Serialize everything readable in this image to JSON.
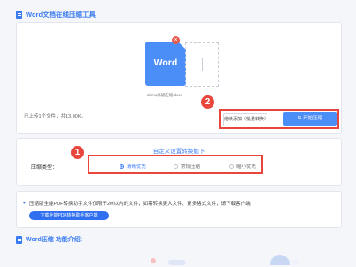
{
  "header": {
    "title": "Word文档在线压缩工具"
  },
  "upload": {
    "file_icon_label": "Word",
    "file_name": "demo高级压缩.docx",
    "summary": "已上传1个文件，共13.00K。",
    "continue_button": "继续添加（批量转换）",
    "start_button": "开始压缩",
    "start_icon": "⇅"
  },
  "settings": {
    "title": "自定义设置转换如下",
    "compression_label": "压缩类型：",
    "options": [
      "清晰优先",
      "常规压缩",
      "缩小优先"
    ],
    "selected": "清晰优先"
  },
  "notice": {
    "text": "压缩版全能PDF转换助手文件仅限于2M以内的文件，如需转换更大文件、更多格式文件，请下载客户端",
    "download_button": "下载全能PDF转换助手客户端"
  },
  "intro": {
    "title": "Word压缩 功能介绍:"
  },
  "annotations": {
    "badge_1": "1",
    "badge_2": "2"
  },
  "colors": {
    "accent": "#3a7bf0",
    "annotation": "#e8453c"
  }
}
